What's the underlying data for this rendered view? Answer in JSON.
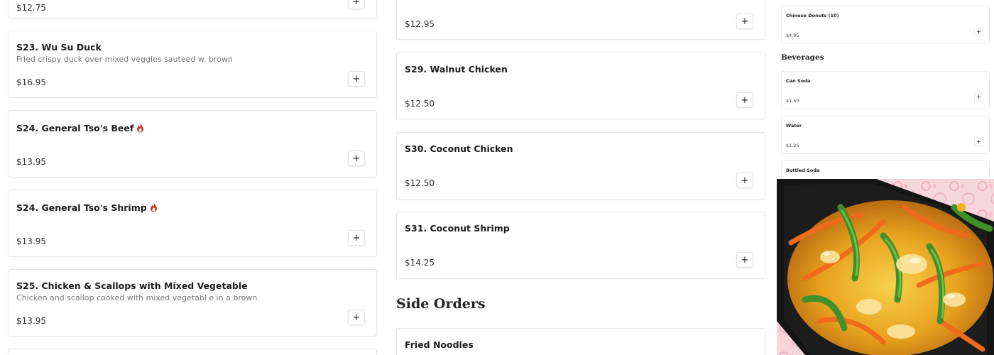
{
  "left_column": {
    "top_partial_price": "$12.75",
    "items": [
      {
        "name": "S23. Wu Su Duck",
        "description": "Fried crispy duck over mixed veggies sauteed w. brown",
        "price": "$16.95",
        "spicy": false
      },
      {
        "name": "S24. General Tso's Beef",
        "description": "",
        "price": "$13.95",
        "spicy": true
      },
      {
        "name": "S24. General Tso's Shrimp",
        "description": "",
        "price": "$13.95",
        "spicy": true
      },
      {
        "name": "S25. Chicken & Scallops with Mixed Vegetable",
        "description": "Chicken and scallop cooked with mixed vegetabl e in a brown",
        "price": "$13.95",
        "spicy": false
      }
    ]
  },
  "middle_column": {
    "top_partial_price": "$12.95",
    "items": [
      {
        "name": "S29. Walnut Chicken",
        "price": "$12.50"
      },
      {
        "name": "S30. Coconut Chicken",
        "price": "$12.50"
      },
      {
        "name": "S31. Coconut Shrimp",
        "price": "$14.25"
      }
    ],
    "side_orders_title": "Side Orders",
    "side_items": [
      {
        "name": "Fried Noodles"
      }
    ]
  },
  "right_column": {
    "top_item": {
      "name": "Chinese Donuts (10)",
      "price": "$4.95"
    },
    "beverages_title": "Beverages",
    "beverages": [
      {
        "name": "Can Soda",
        "price": "$1.50"
      },
      {
        "name": "Water",
        "price": "$1.25"
      },
      {
        "name": "Bottled Soda",
        "price": ""
      }
    ]
  },
  "add_button_symbol": "+",
  "icons": {
    "spicy": "flame-icon",
    "add": "plus-icon"
  },
  "colors": {
    "flame": "#c0392b",
    "card_border": "#e6e6e6",
    "price_text": "#333333"
  }
}
